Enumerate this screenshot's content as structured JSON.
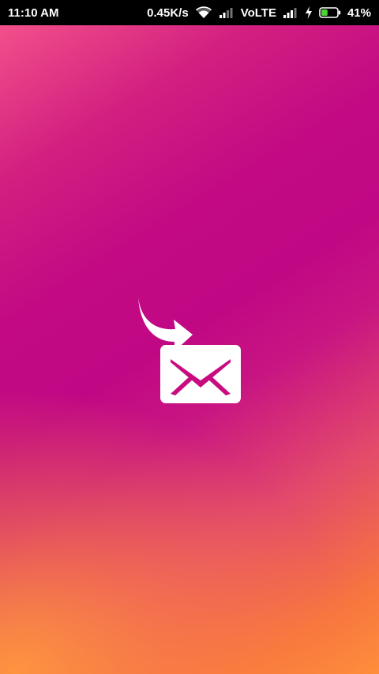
{
  "status_bar": {
    "time": "11:10 AM",
    "network_speed": "0.45K/s",
    "volte_label": "VoLTE",
    "battery_percent": "41%",
    "battery_level": 0.41,
    "icons": [
      "wifi-icon",
      "signal-icon",
      "signal-icon",
      "charging-icon",
      "battery-icon"
    ]
  },
  "splash": {
    "logo_icon": "mail-forward-icon",
    "colors": {
      "status_bar": "#000000",
      "gradient_top": "#c10884",
      "gradient_bottom": "#ff8e3a",
      "logo": "#ffffff",
      "battery_fill": "#4cd137"
    }
  }
}
